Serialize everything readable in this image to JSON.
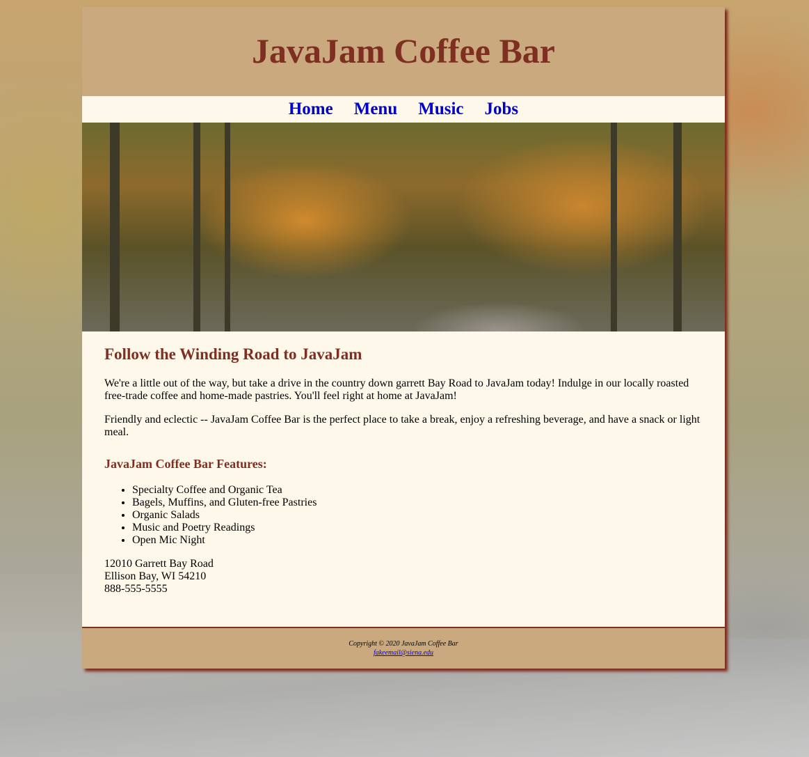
{
  "site": {
    "title": "JavaJam Coffee Bar"
  },
  "nav": [
    {
      "label": "Home"
    },
    {
      "label": "Menu"
    },
    {
      "label": "Music"
    },
    {
      "label": "Jobs"
    }
  ],
  "main": {
    "heading": "Follow the Winding Road to JavaJam",
    "para1": "We're a little out of the way, but take a drive in the country down garrett Bay Road to JavaJam today! Indulge in our locally roasted free-trade coffee and home-made pastries. You'll feel right at home at JavaJam!",
    "para2": "Friendly and eclectic -- JavaJam Coffee Bar is the perfect place to take a break, enjoy a refreshing beverage, and have a snack or light meal.",
    "features_heading": "JavaJam Coffee Bar Features:",
    "features": [
      "Specialty Coffee and Organic Tea",
      "Bagels, Muffins, and Gluten-free Pastries",
      "Organic Salads",
      "Music and Poetry Readings",
      "Open Mic Night"
    ],
    "address": {
      "street": "12010 Garrett Bay Road",
      "city": "Ellison Bay, WI 54210",
      "phone": "888-555-5555"
    }
  },
  "footer": {
    "copyright": "Copyright © 2020 JavaJam Coffee Bar",
    "email": "fakeemail@siena.edu"
  }
}
